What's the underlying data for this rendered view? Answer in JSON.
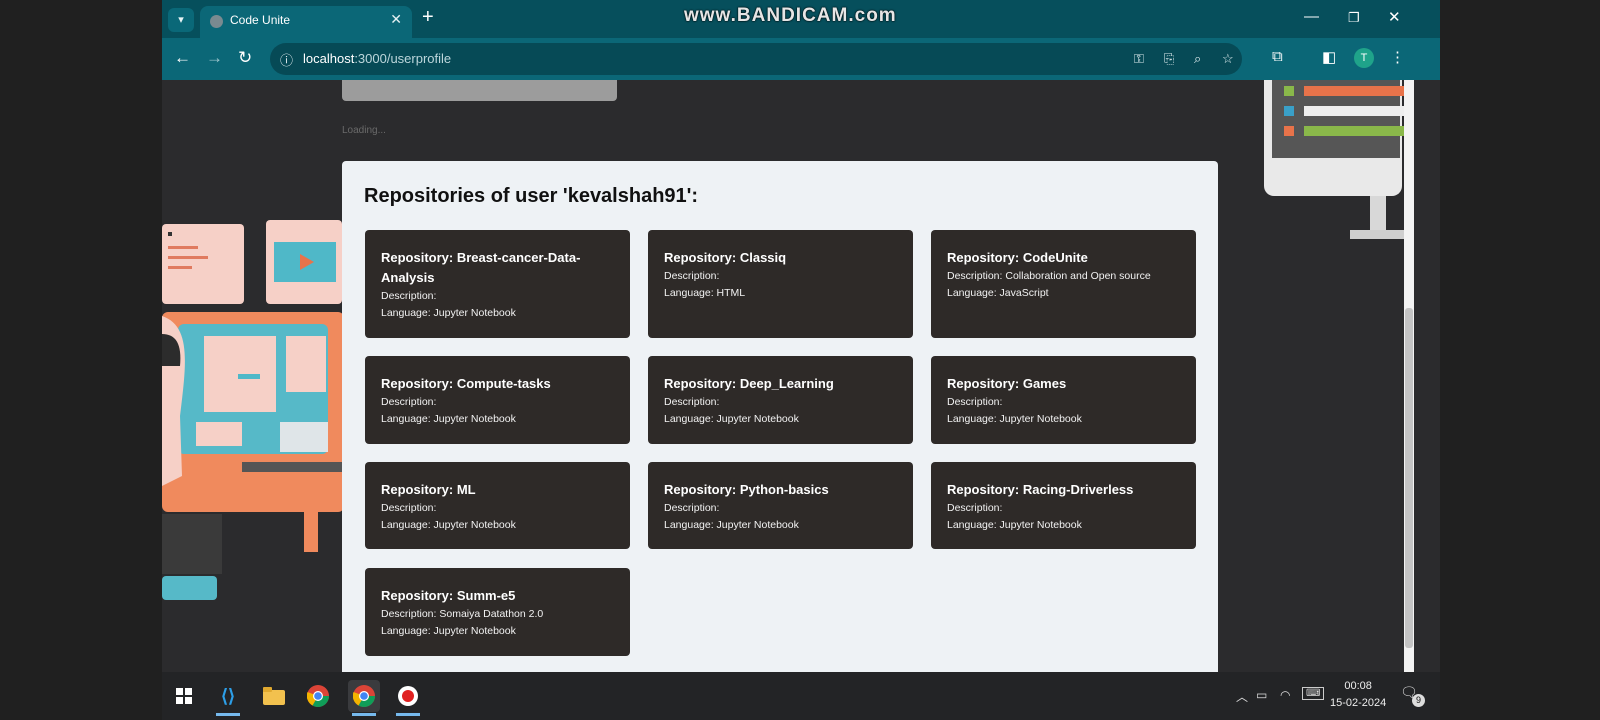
{
  "browser": {
    "tab_title": "Code Unite",
    "tab_search_icon": "chevron-down-icon",
    "watermark": "www.BANDICAM.com",
    "url_host": "localhost",
    "url_path": ":3000/userprofile",
    "profile_initial": "T"
  },
  "page": {
    "loading_text": "Loading...",
    "heading": "Repositories of user 'kevalshah91':",
    "repositories": [
      {
        "name": "Repository: Breast-cancer-Data-Analysis",
        "description": "Description:",
        "language": "Language: Jupyter Notebook"
      },
      {
        "name": "Repository: Classiq",
        "description": "Description:",
        "language": "Language: HTML"
      },
      {
        "name": "Repository: CodeUnite",
        "description": "Description: Collaboration and Open source",
        "language": "Language: JavaScript"
      },
      {
        "name": "Repository: Compute-tasks",
        "description": "Description:",
        "language": "Language: Jupyter Notebook"
      },
      {
        "name": "Repository: Deep_Learning",
        "description": "Description:",
        "language": "Language: Jupyter Notebook"
      },
      {
        "name": "Repository: Games",
        "description": "Description:",
        "language": "Language: Jupyter Notebook"
      },
      {
        "name": "Repository: ML",
        "description": "Description:",
        "language": "Language: Jupyter Notebook"
      },
      {
        "name": "Repository: Python-basics",
        "description": "Description:",
        "language": "Language: Jupyter Notebook"
      },
      {
        "name": "Repository: Racing-Driverless",
        "description": "Description:",
        "language": "Language: Jupyter Notebook"
      },
      {
        "name": "Repository: Summ-e5",
        "description": "Description: Somaiya Datathon 2.0",
        "language": "Language: Jupyter Notebook"
      }
    ]
  },
  "taskbar": {
    "time": "00:08",
    "date": "15-02-2024",
    "notification_count": "9"
  },
  "colors": {
    "tab_strip": "#064f5c",
    "toolbar": "#0b6777",
    "card_bg": "#2e2a28",
    "panel_bg": "#eef2f5"
  }
}
